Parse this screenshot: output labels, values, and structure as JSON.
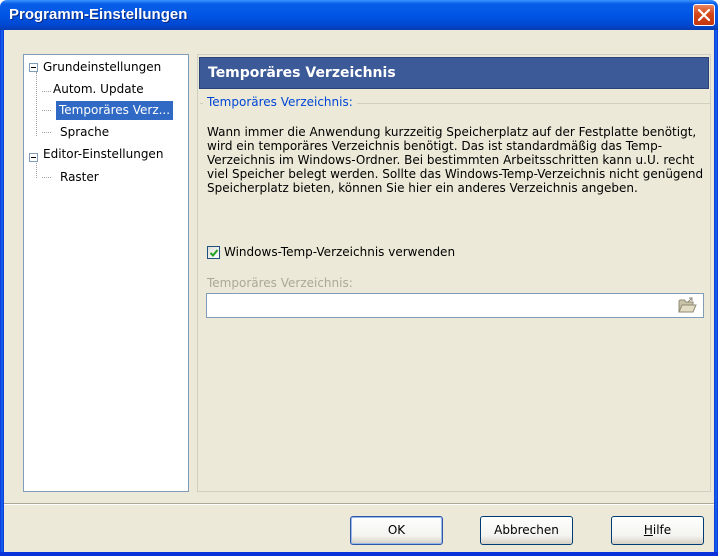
{
  "window": {
    "title": "Programm-Einstellungen"
  },
  "tree": {
    "items": [
      {
        "label": "Grundeinstellungen",
        "level": 0,
        "expanded": true
      },
      {
        "label": "Autom. Update",
        "level": 1
      },
      {
        "label": "Temporäres Verz...",
        "level": 1,
        "selected": true
      },
      {
        "label": "Sprache",
        "level": 1
      },
      {
        "label": "Editor-Einstellungen",
        "level": 0,
        "expanded": true
      },
      {
        "label": "Raster",
        "level": 1
      }
    ]
  },
  "panel": {
    "header": "Temporäres Verzeichnis",
    "group_title": "Temporäres Verzeichnis:",
    "description": "Wann immer die Anwendung kurzzeitig Speicherplatz auf der Festplatte benötigt, wird ein temporäres Verzeichnis benötigt. Das ist standardmäßig das Temp-Verzeichnis im Windows-Ordner. Bei bestimmten Arbeitsschritten kann u.U. recht viel Speicher belegt werden. Sollte das Windows-Temp-Verzeichnis nicht genügend Speicherplatz bieten, können Sie hier ein anderes Verzeichnis angeben.",
    "checkbox_label": "Windows-Temp-Verzeichnis verwenden",
    "checkbox_checked": true,
    "path_label": "Temporäres Verzeichnis:",
    "path_value": ""
  },
  "buttons": {
    "ok": "OK",
    "cancel": "Abbrechen",
    "help_prefix": "",
    "help_mnemonic": "H",
    "help_rest": "ilfe"
  },
  "icons": {
    "close": "close-icon",
    "folder": "folder-open-icon",
    "check": "checkmark-icon",
    "collapse": "minus-expander-icon"
  },
  "colors": {
    "title_bar": "#0055e5",
    "header_bg": "#3d5a98",
    "selection": "#316ac5",
    "group_title": "#0046d5",
    "disabled_text": "#aca899"
  }
}
